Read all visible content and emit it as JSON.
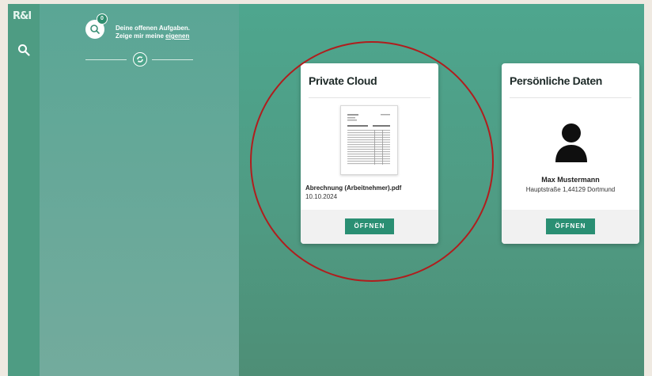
{
  "brand": {
    "logo_text": "R&I"
  },
  "sidebar": {
    "icons": [
      "search-icon"
    ]
  },
  "tasks": {
    "badge_count": "0",
    "line1": "Deine offenen Aufgaben.",
    "line2_prefix": "Zeige mir meine ",
    "line2_link": "eigenen"
  },
  "cards": {
    "private_cloud": {
      "title": "Private Cloud",
      "document_name": "Abrechnung (Arbeitnehmer).pdf",
      "document_date": "10.10.2024",
      "button_label": "ÖFFNEN"
    },
    "personal_data": {
      "title": "Persönliche Daten",
      "name": "Max Mustermann",
      "address": "Hauptstraße 1,44129 Dortmund",
      "button_label": "ÖFFNEN"
    }
  },
  "colors": {
    "accent": "#2a8f73",
    "highlight_ring": "#b01d1d"
  }
}
